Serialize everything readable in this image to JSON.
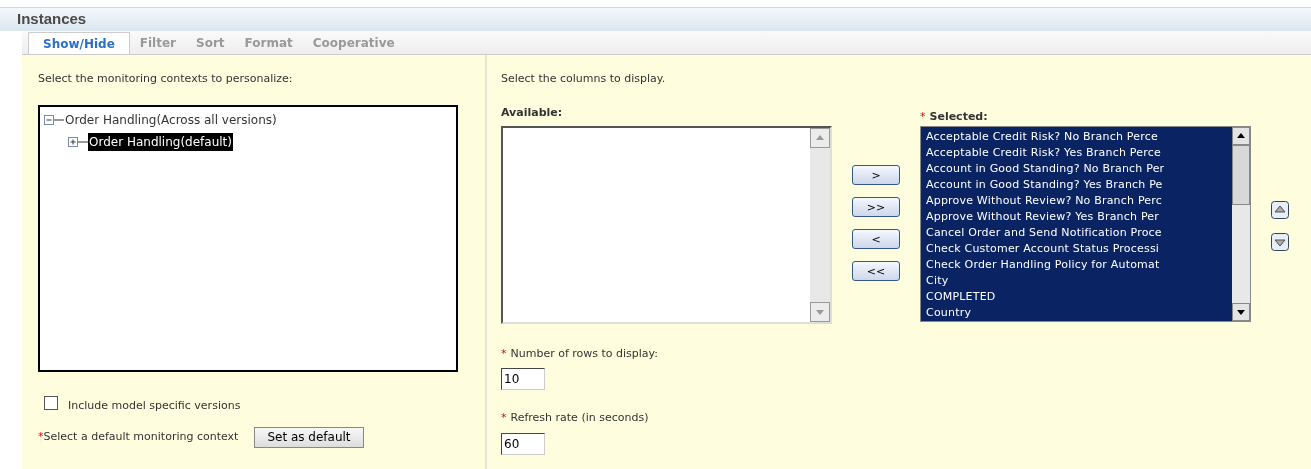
{
  "panel": {
    "title": "Instances"
  },
  "tabs": [
    {
      "label": "Show/Hide",
      "selected": true
    },
    {
      "label": "Filter",
      "selected": false
    },
    {
      "label": "Sort",
      "selected": false
    },
    {
      "label": "Format",
      "selected": false
    },
    {
      "label": "Cooperative",
      "selected": false
    }
  ],
  "contexts": {
    "prompt": "Select the monitoring contexts to personalize:",
    "tree": [
      {
        "label": "Order Handling(Across all versions)",
        "expanded": true,
        "selected": false,
        "children": [
          {
            "label": "Order Handling(default)",
            "expanded": false,
            "selected": true
          }
        ]
      }
    ],
    "include_versions": {
      "label": "Include model specific versions",
      "checked": false
    },
    "default_mark": "*",
    "default_prompt": "Select a default monitoring context",
    "default_button": "Set as default"
  },
  "columns": {
    "prompt": "Select the columns to display.",
    "available_label": "Available:",
    "selected_mark": "*",
    "selected_label": "Selected:",
    "move_buttons": [
      ">",
      ">>",
      "<",
      "<<"
    ],
    "selected": [
      {
        "label": "Acceptable Credit Risk? No Branch Perce",
        "selected": true
      },
      {
        "label": "Acceptable Credit Risk? Yes Branch Perce",
        "selected": true
      },
      {
        "label": "Account in Good Standing? No Branch Per",
        "selected": true
      },
      {
        "label": "Account in Good Standing? Yes Branch Pe",
        "selected": true
      },
      {
        "label": "Approve Without Review? No Branch Perc",
        "selected": true
      },
      {
        "label": "Approve Without Review? Yes Branch Per",
        "selected": true
      },
      {
        "label": "Cancel Order and Send Notification Proce",
        "selected": true
      },
      {
        "label": "Check Customer Account Status Processi",
        "selected": true
      },
      {
        "label": "Check Order Handling Policy for Automat",
        "selected": true
      },
      {
        "label": "City",
        "selected": true
      },
      {
        "label": "COMPLETED",
        "selected": true
      },
      {
        "label": "Country",
        "selected": true
      }
    ],
    "rows_mark": "*",
    "rows_label": "Number of rows to display:",
    "rows_value": "10",
    "refresh_mark": "*",
    "refresh_label": "Refresh rate (in seconds)",
    "refresh_value": "60"
  }
}
